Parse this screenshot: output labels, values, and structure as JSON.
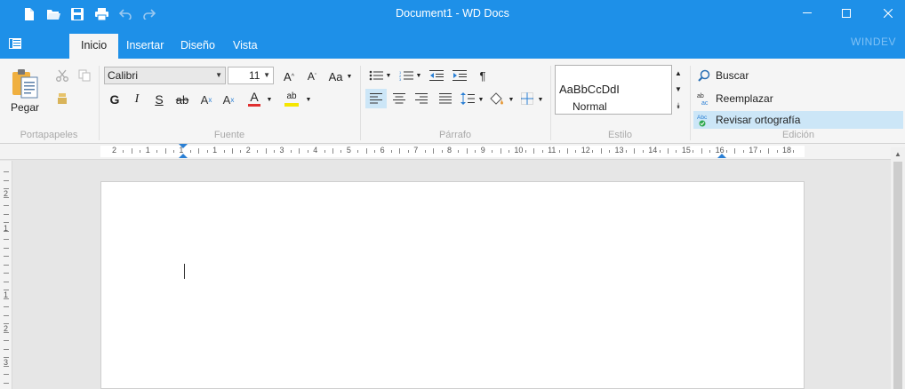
{
  "window": {
    "title": "Document1 - WD Docs",
    "quick_access": [
      "new-document-icon",
      "open-folder-icon",
      "save-icon",
      "print-icon",
      "undo-icon",
      "redo-icon"
    ]
  },
  "tabs": [
    {
      "label": "Inicio",
      "active": true
    },
    {
      "label": "Insertar",
      "active": false
    },
    {
      "label": "Diseño",
      "active": false
    },
    {
      "label": "Vista",
      "active": false
    }
  ],
  "brand": "WINDEV",
  "ribbon": {
    "clipboard": {
      "label": "Portapapeles",
      "paste": "Pegar"
    },
    "font": {
      "label": "Fuente",
      "family": "Calibri",
      "size": "11",
      "case_button": "Aa"
    },
    "paragraph": {
      "label": "Párrafo"
    },
    "style": {
      "label": "Estilo",
      "preview": "AaBbCcDdI",
      "name": "Normal"
    },
    "editing": {
      "label": "Edición",
      "find": "Buscar",
      "replace": "Reemplazar",
      "spellcheck": "Revisar ortografía"
    }
  },
  "ruler": {
    "h_labels": [
      "2",
      "1",
      "1",
      "1",
      "2",
      "3",
      "4",
      "5",
      "6",
      "7",
      "8",
      "9",
      "10",
      "11",
      "12",
      "13",
      "14",
      "15",
      "16",
      "17",
      "18"
    ],
    "v_labels": [
      "2",
      "1",
      "1",
      "2",
      "3"
    ]
  },
  "colors": {
    "accent": "#1e90e8",
    "selected": "#cce6f7",
    "font_color_bar": "#e03030",
    "highlight_bar": "#f5e600"
  }
}
